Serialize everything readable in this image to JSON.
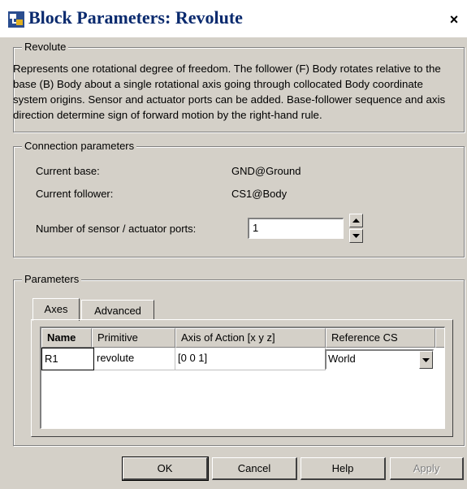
{
  "window": {
    "title": "Block Parameters: Revolute",
    "close_glyph": "×",
    "icon": "simulink-block-icon"
  },
  "description_group": {
    "title": "Revolute",
    "text": "Represents one rotational degree of freedom. The follower (F) Body rotates relative to the base (B) Body about a single rotational axis going through collocated Body coordinate system origins. Sensor and actuator ports can be added. Base-follower sequence and axis direction determine sign of forward motion by the right-hand rule."
  },
  "connection": {
    "title": "Connection parameters",
    "base_label": "Current base:",
    "base_value": "GND@Ground",
    "follower_label": "Current follower:",
    "follower_value": "CS1@Body",
    "ports_label": "Number of sensor / actuator ports:",
    "ports_value": "1"
  },
  "parameters": {
    "title": "Parameters",
    "tabs": [
      {
        "label": "Axes",
        "active": true
      },
      {
        "label": "Advanced",
        "active": false
      }
    ],
    "table": {
      "headers": [
        "Name",
        "Primitive",
        "Axis of Action [x y z]",
        "Reference CS"
      ],
      "rows": [
        {
          "name": "R1",
          "primitive": "revolute",
          "axis": "[0 0 1]",
          "reference": "World"
        }
      ]
    }
  },
  "buttons": {
    "ok": "OK",
    "cancel": "Cancel",
    "help": "Help",
    "apply": "Apply"
  }
}
